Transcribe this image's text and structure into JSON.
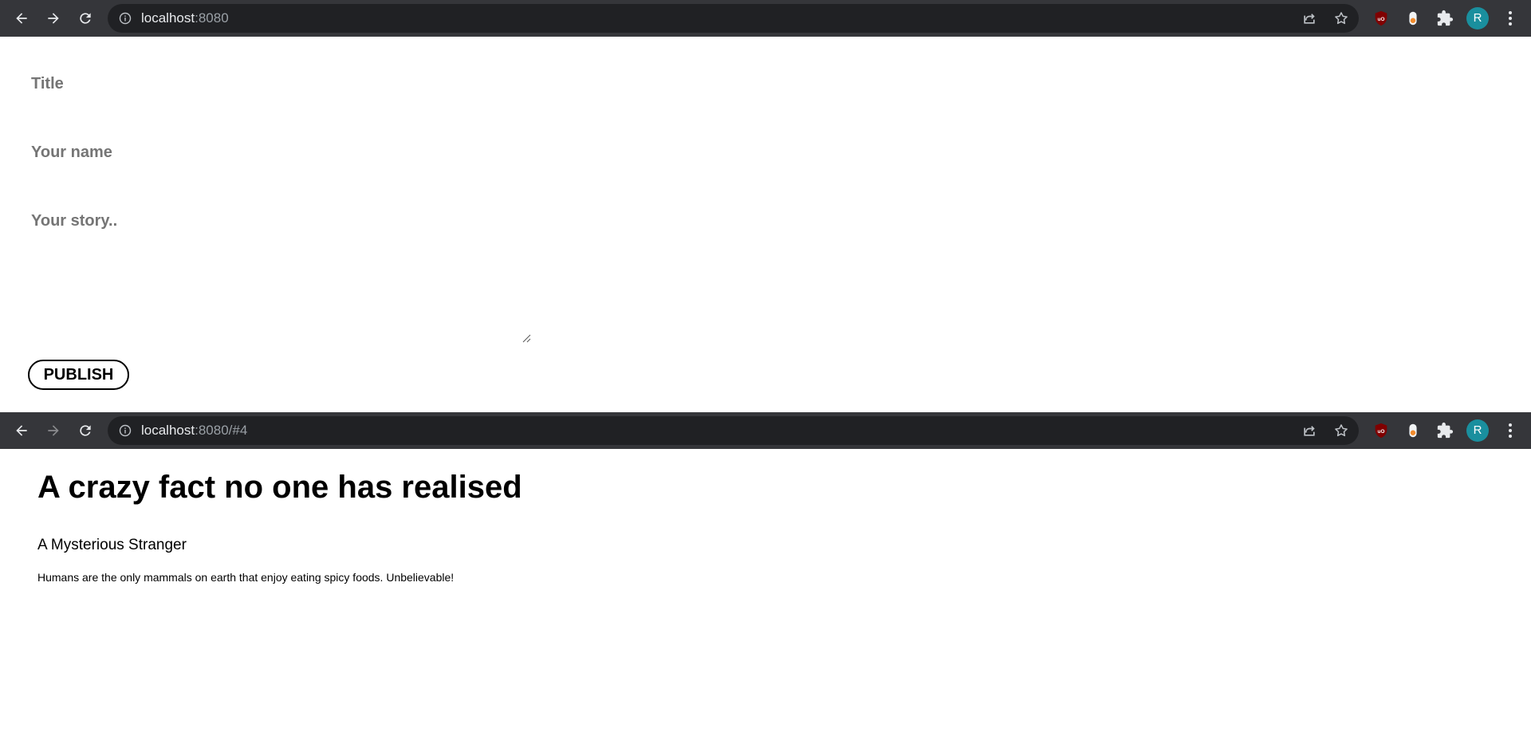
{
  "browser_top": {
    "url_host": "localhost",
    "url_rest": ":8080",
    "avatar_letter": "R"
  },
  "browser_bottom": {
    "url_host": "localhost",
    "url_rest": ":8080/#4",
    "avatar_letter": "R"
  },
  "toolbar_icons": [
    "back-icon",
    "forward-icon",
    "reload-icon",
    "site-info-icon",
    "share-icon",
    "bookmark-star-icon",
    "ublock-icon",
    "extension-orange-icon",
    "extensions-puzzle-icon",
    "menu-dots-icon"
  ],
  "form": {
    "title_placeholder": "Title",
    "name_placeholder": "Your name",
    "story_placeholder": "Your story..",
    "publish_label": "PUBLISH"
  },
  "story": {
    "title": "A crazy fact no one has realised",
    "author": "A Mysterious Stranger",
    "body": "Humans are the only mammals on earth that enjoy eating spicy foods. Unbelievable!"
  },
  "colors": {
    "toolbar_bg": "#35363a",
    "omnibox_bg": "#202124",
    "avatar_bg": "#1a8f9e",
    "placeholder_text": "#757575",
    "ublock_red": "#800000"
  }
}
